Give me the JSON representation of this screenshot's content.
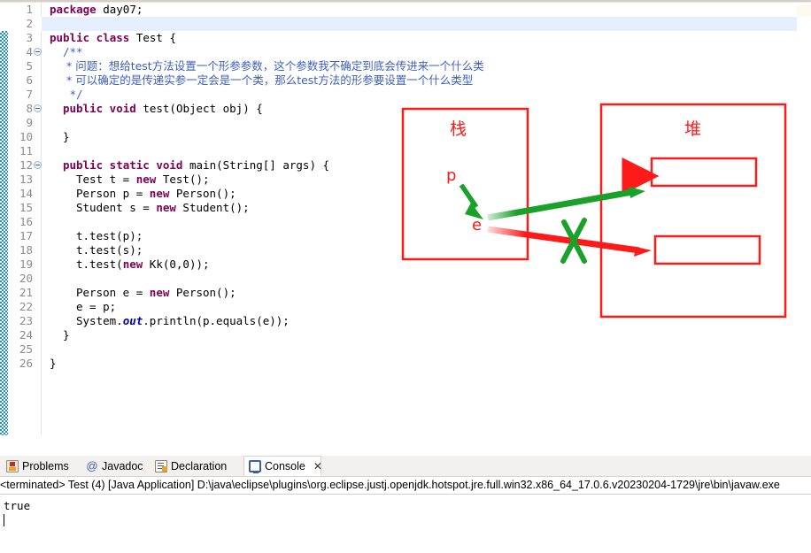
{
  "editor": {
    "lines": [
      {
        "n": "1",
        "fold": false,
        "segments": [
          {
            "t": "package ",
            "c": "kw"
          },
          {
            "t": "day07;",
            "c": ""
          }
        ]
      },
      {
        "n": "2",
        "fold": false,
        "segments": []
      },
      {
        "n": "3",
        "fold": false,
        "segments": [
          {
            "t": "public class ",
            "c": "kw"
          },
          {
            "t": "Test {",
            "c": ""
          }
        ]
      },
      {
        "n": "4",
        "fold": true,
        "indent": 2,
        "segments": [
          {
            "t": "/**",
            "c": "cmt"
          }
        ]
      },
      {
        "n": "5",
        "fold": false,
        "indent": 2,
        "segments": [
          {
            "t": " * 问题：想给test方法设置一个形参参数，这个参数我不确定到底会传进来一个什么类",
            "c": "cmt cmt-cn"
          }
        ]
      },
      {
        "n": "6",
        "fold": false,
        "indent": 2,
        "segments": [
          {
            "t": " * 可以确定的是传递实参一定会是一个类，那么test方法的形参要设置一个什么类型",
            "c": "cmt cmt-cn"
          }
        ]
      },
      {
        "n": "7",
        "fold": false,
        "indent": 2,
        "segments": [
          {
            "t": " */",
            "c": "cmt"
          }
        ]
      },
      {
        "n": "8",
        "fold": true,
        "indent": 2,
        "segments": [
          {
            "t": "public void ",
            "c": "kw"
          },
          {
            "t": "test(Object obj) {",
            "c": ""
          }
        ]
      },
      {
        "n": "9",
        "fold": false,
        "segments": []
      },
      {
        "n": "10",
        "fold": false,
        "indent": 2,
        "segments": [
          {
            "t": "}",
            "c": ""
          }
        ]
      },
      {
        "n": "11",
        "fold": false,
        "segments": []
      },
      {
        "n": "12",
        "fold": true,
        "indent": 2,
        "segments": [
          {
            "t": "public static void ",
            "c": "kw"
          },
          {
            "t": "main(String[] args) {",
            "c": ""
          }
        ]
      },
      {
        "n": "13",
        "fold": false,
        "indent": 4,
        "segments": [
          {
            "t": "Test t = ",
            "c": ""
          },
          {
            "t": "new ",
            "c": "kw"
          },
          {
            "t": "Test();",
            "c": ""
          }
        ]
      },
      {
        "n": "14",
        "fold": false,
        "indent": 4,
        "segments": [
          {
            "t": "Person p = ",
            "c": ""
          },
          {
            "t": "new ",
            "c": "kw"
          },
          {
            "t": "Person();",
            "c": ""
          }
        ]
      },
      {
        "n": "15",
        "fold": false,
        "indent": 4,
        "segments": [
          {
            "t": "Student s = ",
            "c": ""
          },
          {
            "t": "new ",
            "c": "kw"
          },
          {
            "t": "Student();",
            "c": ""
          }
        ]
      },
      {
        "n": "16",
        "fold": false,
        "segments": []
      },
      {
        "n": "17",
        "fold": false,
        "indent": 4,
        "segments": [
          {
            "t": "t.test(p);",
            "c": ""
          }
        ]
      },
      {
        "n": "18",
        "fold": false,
        "indent": 4,
        "segments": [
          {
            "t": "t.test(s);",
            "c": ""
          }
        ]
      },
      {
        "n": "19",
        "fold": false,
        "indent": 4,
        "segments": [
          {
            "t": "t.test(",
            "c": ""
          },
          {
            "t": "new ",
            "c": "kw"
          },
          {
            "t": "Kk(0,0));",
            "c": ""
          }
        ]
      },
      {
        "n": "20",
        "fold": false,
        "segments": []
      },
      {
        "n": "21",
        "fold": false,
        "indent": 4,
        "segments": [
          {
            "t": "Person e = ",
            "c": ""
          },
          {
            "t": "new ",
            "c": "kw"
          },
          {
            "t": "Person();",
            "c": ""
          }
        ]
      },
      {
        "n": "22",
        "fold": false,
        "indent": 4,
        "segments": [
          {
            "t": "e = p;",
            "c": ""
          }
        ]
      },
      {
        "n": "23",
        "fold": false,
        "indent": 4,
        "segments": [
          {
            "t": "System.",
            "c": ""
          },
          {
            "t": "out",
            "c": "stat"
          },
          {
            "t": ".println(p.equals(e));",
            "c": ""
          }
        ]
      },
      {
        "n": "24",
        "fold": false,
        "indent": 2,
        "segments": [
          {
            "t": "}",
            "c": ""
          }
        ]
      },
      {
        "n": "25",
        "fold": false,
        "segments": []
      },
      {
        "n": "26",
        "fold": false,
        "segments": [
          {
            "t": "}",
            "c": ""
          }
        ]
      }
    ],
    "current_line": 2,
    "hscroll_arrow": "«"
  },
  "diagram": {
    "stack_label": "栈",
    "heap_label": "堆",
    "var_p": "p",
    "var_e": "e",
    "colors": {
      "red": "#ff1a1a",
      "green": "#1aa12a"
    },
    "heap_slots": [
      "",
      ""
    ]
  },
  "bottom_panel": {
    "tabs": [
      {
        "label": "Problems",
        "icon": "problems-icon",
        "active": false
      },
      {
        "label": "Javadoc",
        "icon": "at-icon",
        "active": false
      },
      {
        "label": "Declaration",
        "icon": "declaration-icon",
        "active": false
      },
      {
        "label": "Console",
        "icon": "console-icon",
        "active": true,
        "close": "✕"
      }
    ],
    "terminated_line": "<terminated> Test (4) [Java Application] D:\\java\\eclipse\\plugins\\org.eclipse.justj.openjdk.hotspot.jre.full.win32.x86_64_17.0.6.v20230204-1729\\jre\\bin\\javaw.exe",
    "output": [
      "true"
    ]
  }
}
